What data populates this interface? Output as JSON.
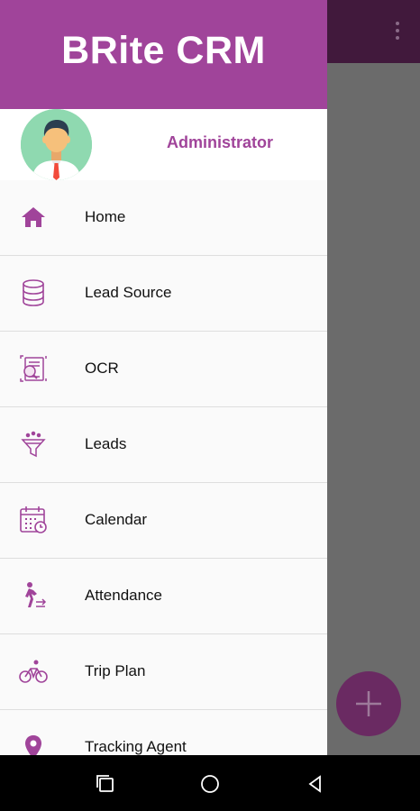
{
  "app": {
    "title": "BRite CRM",
    "role": "Administrator",
    "accent_color": "#a0449a"
  },
  "toolbar": {
    "overflow_icon": "more-vert-icon"
  },
  "menu": {
    "items": [
      {
        "label": "Home",
        "icon": "home-icon"
      },
      {
        "label": "Lead Source",
        "icon": "database-icon"
      },
      {
        "label": "OCR",
        "icon": "ocr-document-icon"
      },
      {
        "label": "Leads",
        "icon": "funnel-icon"
      },
      {
        "label": "Calendar",
        "icon": "calendar-icon"
      },
      {
        "label": "Attendance",
        "icon": "walking-person-icon"
      },
      {
        "label": "Trip Plan",
        "icon": "bicycle-icon"
      },
      {
        "label": "Tracking Agent",
        "icon": "location-pin-icon"
      }
    ]
  },
  "fab": {
    "icon": "plus-icon"
  },
  "navbar": {
    "buttons": [
      "recents-icon",
      "home-circle-icon",
      "back-icon"
    ]
  }
}
